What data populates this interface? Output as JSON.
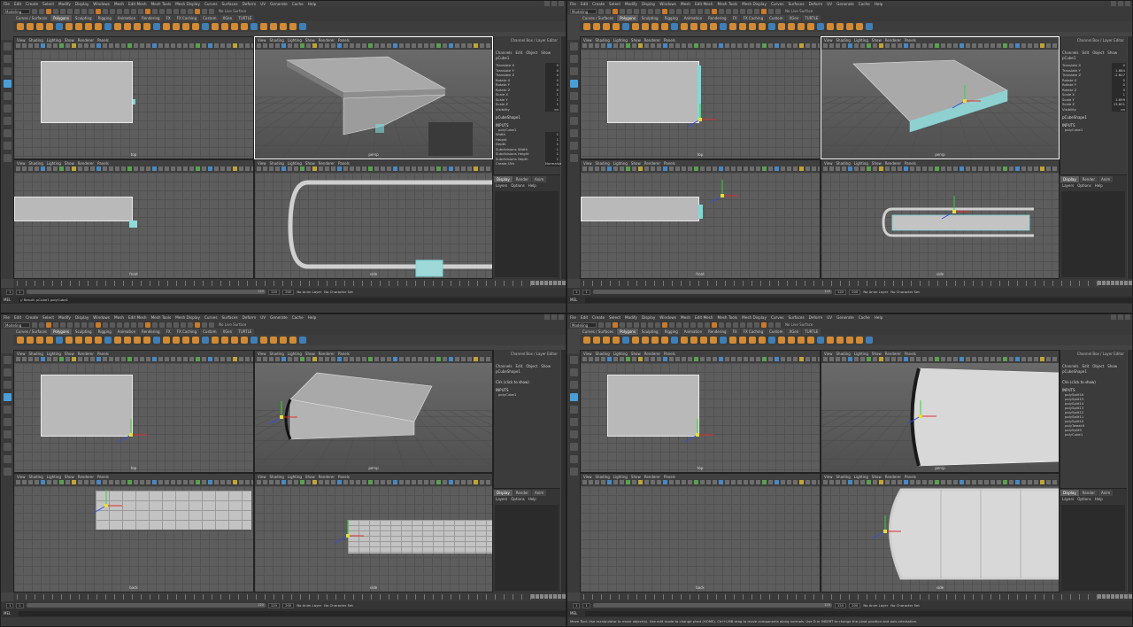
{
  "menu": [
    "File",
    "Edit",
    "Create",
    "Select",
    "Modify",
    "Display",
    "Windows",
    "Mesh",
    "Edit Mesh",
    "Mesh Tools",
    "Mesh Display",
    "Curves",
    "Surfaces",
    "Deform",
    "UV",
    "Generate",
    "Cache",
    "Help"
  ],
  "mode": "Modeling",
  "live_surface": "No Live Surface",
  "shelf_tabs": [
    "Curves / Surfaces",
    "Polygons",
    "Sculpting",
    "Rigging",
    "Animation",
    "Rendering",
    "FX",
    "FX Caching",
    "Custom",
    "XGen",
    "TURTLE"
  ],
  "shelf_active": "Polygons",
  "viewport_menu": [
    "View",
    "Shading",
    "Lighting",
    "Show",
    "Renderer",
    "Panels"
  ],
  "panel_title": "Channel Box / Layer Editor",
  "channel_menu": [
    "Channels",
    "Edit",
    "Object",
    "Show"
  ],
  "layer_tabs": [
    "Display",
    "Render",
    "Anim"
  ],
  "layer_menu": [
    "Layers",
    "Options",
    "Help"
  ],
  "cmd_tag": "MEL",
  "range": {
    "start": "1",
    "end": "120",
    "max": "200",
    "current": "1"
  },
  "anim_layer": "No Anim Layer",
  "char_set": "No Character Set",
  "help_text": "Move Tool: Use manipulator to move object(s). Use edit mode to change pivot (HOME). Ctrl+LMB-drag to move components along normals. Use D or INSERT to change the pivot position and axis orientation.",
  "quads": [
    {
      "vp_labels": [
        "top",
        "persp",
        "front",
        "side"
      ],
      "object": "pCube1",
      "attrs": [
        {
          "n": "Translate X",
          "v": "0"
        },
        {
          "n": "Translate Y",
          "v": "0"
        },
        {
          "n": "Translate Z",
          "v": "0"
        },
        {
          "n": "Rotate X",
          "v": "0"
        },
        {
          "n": "Rotate Y",
          "v": "0"
        },
        {
          "n": "Rotate Z",
          "v": "0"
        },
        {
          "n": "Scale X",
          "v": "1"
        },
        {
          "n": "Scale Y",
          "v": "1"
        },
        {
          "n": "Scale Z",
          "v": "1"
        },
        {
          "n": "Visibility",
          "v": "on"
        }
      ],
      "shapes": "pCubeShape1",
      "inputs": [
        "polyCube1"
      ],
      "input_attrs": [
        {
          "n": "Width",
          "v": "1"
        },
        {
          "n": "Height",
          "v": "1"
        },
        {
          "n": "Depth",
          "v": "1"
        },
        {
          "n": "Subdivisions Width",
          "v": "1"
        },
        {
          "n": "Subdivisions Height",
          "v": "1"
        },
        {
          "n": "Subdivisions Depth",
          "v": "1"
        },
        {
          "n": "Create UVs",
          "v": "Normalize"
        }
      ],
      "cmd": "// Result: pCube1 polyCube1"
    },
    {
      "vp_labels": [
        "top",
        "persp",
        "front",
        "side"
      ],
      "object": "pCube1",
      "attrs": [
        {
          "n": "Translate X",
          "v": "0"
        },
        {
          "n": "Translate Y",
          "v": "1.884"
        },
        {
          "n": "Translate Z",
          "v": "-2.607"
        },
        {
          "n": "Rotate X",
          "v": "0"
        },
        {
          "n": "Rotate Y",
          "v": "0"
        },
        {
          "n": "Rotate Z",
          "v": "0"
        },
        {
          "n": "Scale X",
          "v": "1"
        },
        {
          "n": "Scale Y",
          "v": "1.699"
        },
        {
          "n": "Scale Z",
          "v": "13.601"
        },
        {
          "n": "Visibility",
          "v": "on"
        }
      ],
      "shapes": "pCubeShape1",
      "inputs": [
        "polyCube1"
      ],
      "input_attrs": [],
      "cmd": ""
    },
    {
      "vp_labels": [
        "top",
        "persp",
        "back",
        "side"
      ],
      "object": "pCubeShape1",
      "attrs": [],
      "shapes": "CVs (click to show)",
      "inputs": [
        "polyCube1"
      ],
      "input_attrs": [],
      "cmd": ""
    },
    {
      "vp_labels": [
        "top",
        "persp",
        "back",
        "side"
      ],
      "object": "pCubeShape1",
      "attrs": [],
      "shapes": "CVs (click to show)",
      "inputs": [
        "polySplit16",
        "polySplit15",
        "polySplit14",
        "polySplit13",
        "polySplit12",
        "polySplit11",
        "polySplit10",
        "polyTweak9",
        "polySplit9",
        "polyCube1"
      ],
      "input_attrs": [],
      "cmd": ""
    }
  ]
}
